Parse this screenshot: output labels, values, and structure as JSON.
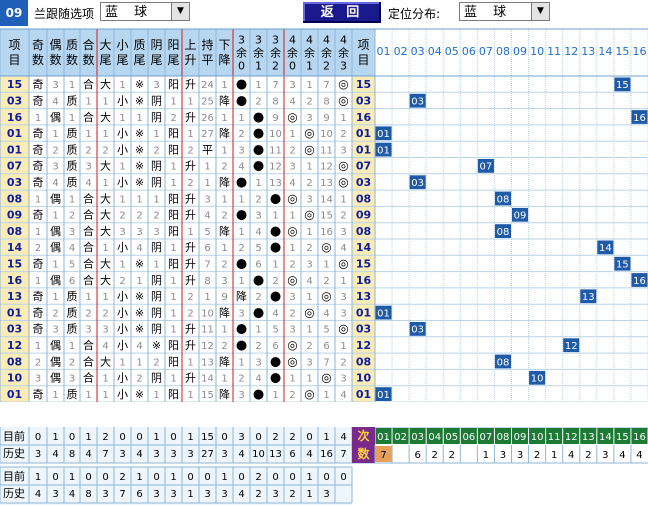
{
  "toolbar": {
    "issue": "09",
    "follow_label": "兰跟随选项",
    "follow_value": "蓝 球",
    "back_label": "返 回",
    "position_label": "定位分布:",
    "position_value": "蓝 球"
  },
  "table": {
    "columns": [
      "项目",
      "奇数",
      "偶数",
      "质数",
      "合数",
      "大尾",
      "小尾",
      "质尾",
      "阴尾",
      "阳尾",
      "上升",
      "持平",
      "下降",
      "3余0",
      "3余1",
      "3余2",
      "4余0",
      "4余1",
      "4余2",
      "4余3",
      "项目"
    ],
    "positions": [
      "01",
      "02",
      "03",
      "04",
      "05",
      "06",
      "07",
      "08",
      "09",
      "10",
      "11",
      "12",
      "13",
      "14",
      "15",
      "16"
    ],
    "rows": [
      [
        "15",
        "奇",
        "3",
        "1",
        "合",
        "大",
        "1",
        "※",
        "3",
        "阳",
        "升",
        "24",
        "1",
        "●",
        "1",
        "7",
        "3",
        "1",
        "7",
        "◎"
      ],
      [
        "03",
        "奇",
        "4",
        "质",
        "1",
        "1",
        "小",
        "※",
        "阴",
        "1",
        "1",
        "25",
        "降",
        "●",
        "2",
        "8",
        "4",
        "2",
        "8",
        "◎"
      ],
      [
        "16",
        "1",
        "偶",
        "1",
        "合",
        "大",
        "1",
        "1",
        "阴",
        "2",
        "升",
        "26",
        "1",
        "1",
        "●",
        "9",
        "◎",
        "3",
        "9",
        "1"
      ],
      [
        "01",
        "奇",
        "1",
        "质",
        "1",
        "1",
        "小",
        "※",
        "1",
        "阳",
        "1",
        "27",
        "降",
        "2",
        "●",
        "10",
        "1",
        "◎",
        "10",
        "2"
      ],
      [
        "01",
        "奇",
        "2",
        "质",
        "2",
        "2",
        "小",
        "※",
        "2",
        "阳",
        "2",
        "平",
        "1",
        "3",
        "●",
        "11",
        "2",
        "◎",
        "11",
        "3"
      ],
      [
        "07",
        "奇",
        "3",
        "质",
        "3",
        "大",
        "1",
        "※",
        "阴",
        "1",
        "升",
        "1",
        "2",
        "4",
        "●",
        "12",
        "3",
        "1",
        "12",
        "◎"
      ],
      [
        "03",
        "奇",
        "4",
        "质",
        "4",
        "1",
        "小",
        "※",
        "阴",
        "1",
        "2",
        "1",
        "降",
        "●",
        "1",
        "13",
        "4",
        "2",
        "13",
        "◎"
      ],
      [
        "08",
        "1",
        "偶",
        "1",
        "合",
        "大",
        "1",
        "1",
        "1",
        "阳",
        "升",
        "3",
        "1",
        "1",
        "2",
        "●",
        "◎",
        "3",
        "14",
        "1"
      ],
      [
        "09",
        "奇",
        "1",
        "2",
        "合",
        "大",
        "2",
        "2",
        "2",
        "阳",
        "升",
        "4",
        "2",
        "●",
        "3",
        "1",
        "1",
        "◎",
        "15",
        "2"
      ],
      [
        "08",
        "1",
        "偶",
        "3",
        "合",
        "大",
        "3",
        "3",
        "3",
        "阳",
        "1",
        "5",
        "降",
        "1",
        "4",
        "●",
        "◎",
        "1",
        "16",
        "3"
      ],
      [
        "14",
        "2",
        "偶",
        "4",
        "合",
        "1",
        "小",
        "4",
        "阴",
        "1",
        "升",
        "6",
        "1",
        "2",
        "5",
        "●",
        "1",
        "2",
        "◎",
        "4"
      ],
      [
        "15",
        "奇",
        "1",
        "5",
        "合",
        "大",
        "1",
        "※",
        "1",
        "阳",
        "升",
        "7",
        "2",
        "●",
        "6",
        "1",
        "2",
        "3",
        "1",
        "◎"
      ],
      [
        "16",
        "1",
        "偶",
        "6",
        "合",
        "大",
        "2",
        "1",
        "阴",
        "1",
        "升",
        "8",
        "3",
        "1",
        "●",
        "2",
        "◎",
        "4",
        "2",
        "1"
      ],
      [
        "13",
        "奇",
        "1",
        "质",
        "1",
        "1",
        "小",
        "※",
        "阴",
        "1",
        "2",
        "1",
        "9",
        "降",
        "2",
        "●",
        "3",
        "1",
        "◎",
        "3"
      ],
      [
        "01",
        "奇",
        "2",
        "质",
        "2",
        "2",
        "小",
        "※",
        "阴",
        "1",
        "2",
        "10",
        "降",
        "3",
        "●",
        "4",
        "2",
        "◎",
        "4",
        "3"
      ],
      [
        "03",
        "奇",
        "3",
        "质",
        "3",
        "3",
        "小",
        "※",
        "阴",
        "1",
        "升",
        "11",
        "1",
        "●",
        "1",
        "5",
        "3",
        "1",
        "5",
        "◎"
      ],
      [
        "12",
        "1",
        "偶",
        "1",
        "合",
        "4",
        "小",
        "4",
        "※",
        "阳",
        "升",
        "12",
        "2",
        "●",
        "2",
        "6",
        "◎",
        "2",
        "6",
        "1"
      ],
      [
        "08",
        "2",
        "偶",
        "2",
        "合",
        "大",
        "1",
        "1",
        "2",
        "阳",
        "1",
        "13",
        "降",
        "1",
        "3",
        "●",
        "◎",
        "3",
        "7",
        "2"
      ],
      [
        "10",
        "3",
        "偶",
        "3",
        "合",
        "1",
        "小",
        "2",
        "阴",
        "1",
        "升",
        "14",
        "1",
        "2",
        "4",
        "●",
        "1",
        "1",
        "◎",
        "3"
      ],
      [
        "01",
        "奇",
        "1",
        "质",
        "1",
        "1",
        "小",
        "※",
        "1",
        "阳",
        "1",
        "15",
        "降",
        "3",
        "●",
        "1",
        "2",
        "◎",
        "1",
        "4"
      ]
    ],
    "hits": [
      15,
      3,
      16,
      1,
      1,
      7,
      3,
      8,
      9,
      8,
      14,
      15,
      16,
      13,
      1,
      3,
      12,
      8,
      10,
      1
    ]
  },
  "stats": {
    "current_label": "目前",
    "history_label": "历史",
    "current": [
      "0",
      "1",
      "0",
      "1",
      "2",
      "0",
      "0",
      "1",
      "0",
      "1",
      "15",
      "0",
      "3",
      "0",
      "2",
      "2",
      "0",
      "1",
      "4"
    ],
    "history": [
      "3",
      "4",
      "8",
      "4",
      "7",
      "3",
      "4",
      "3",
      "3",
      "3",
      "27",
      "3",
      "4",
      "10",
      "13",
      "6",
      "4",
      "16",
      "7"
    ],
    "next_label": "次数",
    "next_positions": [
      "01",
      "02",
      "03",
      "04",
      "05",
      "06",
      "07",
      "08",
      "09",
      "10",
      "11",
      "12",
      "13",
      "14",
      "15",
      "16"
    ],
    "next_counts": [
      "7",
      "",
      "6",
      "2",
      "2",
      "",
      "1",
      "3",
      "3",
      "2",
      "1",
      "4",
      "2",
      "3",
      "4",
      "4"
    ],
    "bottom_current": [
      "1",
      "0",
      "1",
      "0",
      "0",
      "2",
      "1",
      "0",
      "1",
      "0",
      "0",
      "1",
      "0",
      "2",
      "0",
      "0",
      "1",
      "0",
      "0"
    ],
    "bottom_history": [
      "4",
      "3",
      "4",
      "8",
      "3",
      "7",
      "6",
      "3",
      "3",
      "1",
      "3",
      "3",
      "4",
      "2",
      "3",
      "2",
      "1",
      "3"
    ]
  },
  "colors": {
    "header_bg": "#b7d7f1",
    "row_label_bg": "#f9ecb6",
    "row_label_fg": "#0f1d9c",
    "hit_bg": "#1e5aa8",
    "red_line": "#cc1c1c",
    "next_bg": "#7a2a8a",
    "next_pos_bg": "#1c7a34",
    "accent_orange": "#e7a05a"
  }
}
